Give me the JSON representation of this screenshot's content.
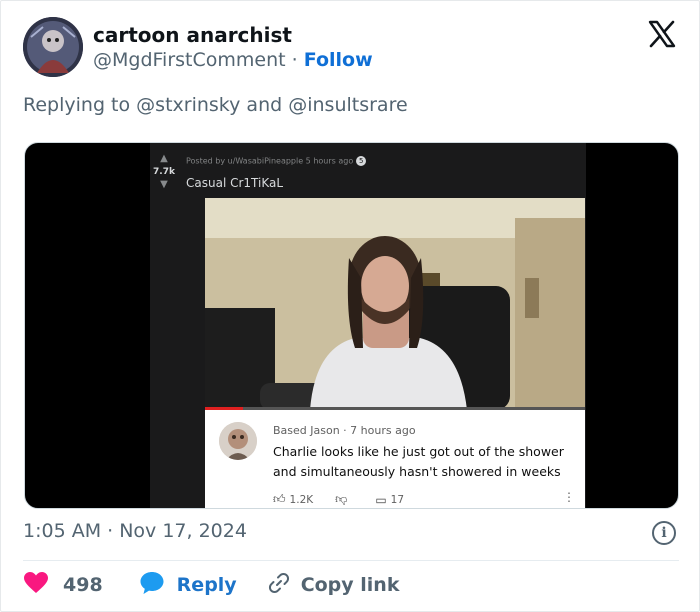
{
  "author": {
    "display_name": "cartoon anarchist",
    "handle": "@MgdFirstComment",
    "separator": "·",
    "follow_label": "Follow"
  },
  "reply": {
    "prefix": "Replying to",
    "mention_1": "@stxrinsky",
    "conjunction": "and",
    "mention_2": "@insultsrare"
  },
  "media": {
    "reddit": {
      "vote_count": "7.7k",
      "posted_by": "Posted by u/WasabiPineapple 5 hours ago",
      "badge": "5",
      "title": "Casual Cr1TiKaL"
    },
    "video_progress": 0.1,
    "comment": {
      "author_time": "Based Jason · 7 hours ago",
      "text": "Charlie looks like he just got out of the shower and simultaneously hasn't showered in weeks",
      "likes": "1.2K",
      "replies": "17"
    }
  },
  "footer": {
    "timestamp": "1:05 AM · Nov 17, 2024",
    "like_count": "498",
    "reply_label": "Reply",
    "copy_label": "Copy link"
  },
  "colors": {
    "like": "#f91880",
    "reply": "#1d9bf0",
    "follow": "#0f6fd6"
  }
}
